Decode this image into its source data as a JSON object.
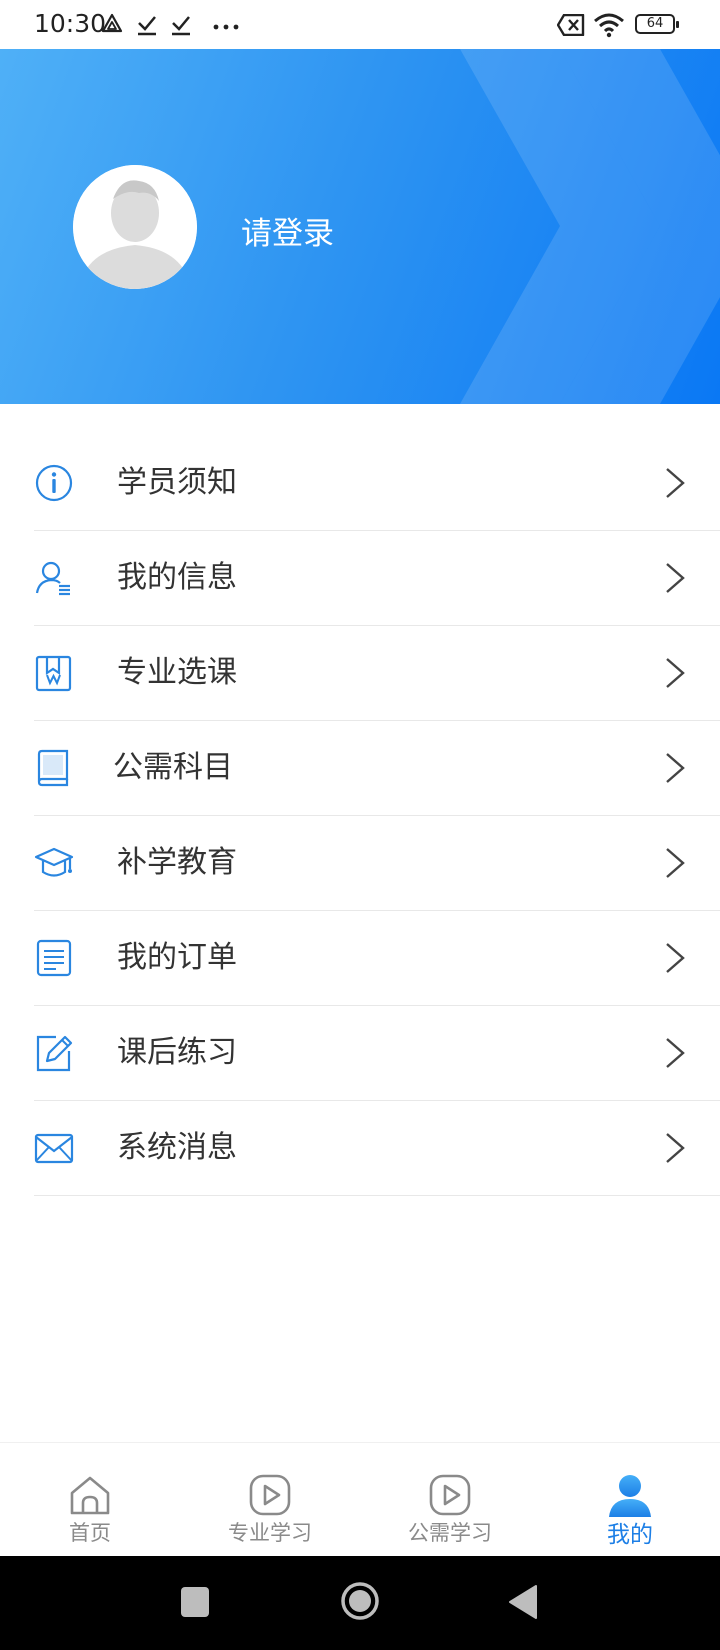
{
  "status_bar": {
    "time": "10:30",
    "battery": "64"
  },
  "header": {
    "login_prompt": "请登录"
  },
  "menu": {
    "items": [
      {
        "label": "学员须知",
        "icon": "info-icon"
      },
      {
        "label": "我的信息",
        "icon": "user-info-icon"
      },
      {
        "label": "专业选课",
        "icon": "bookmark-course-icon"
      },
      {
        "label": "公需科目",
        "icon": "book-icon"
      },
      {
        "label": "补学教育",
        "icon": "graduation-cap-icon"
      },
      {
        "label": "我的订单",
        "icon": "order-document-icon"
      },
      {
        "label": "课后练习",
        "icon": "edit-pencil-icon"
      },
      {
        "label": "系统消息",
        "icon": "mail-icon"
      }
    ]
  },
  "tab_bar": {
    "tabs": [
      {
        "label": "首页",
        "icon": "home-icon",
        "active": false
      },
      {
        "label": "专业学习",
        "icon": "play-icon",
        "active": false
      },
      {
        "label": "公需学习",
        "icon": "play-icon",
        "active": false
      },
      {
        "label": "我的",
        "icon": "person-icon",
        "active": true
      }
    ]
  },
  "colors": {
    "accent": "#1d7fe6",
    "header_start": "#4fb0f7",
    "header_end": "#0a78f4",
    "label": "#333333",
    "tab_inactive": "#8a8a8a"
  }
}
